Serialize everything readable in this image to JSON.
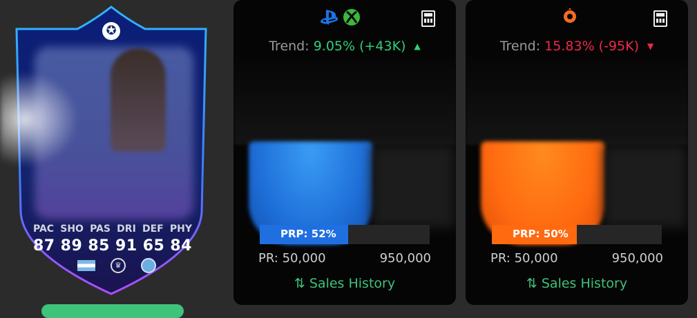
{
  "card": {
    "stat_labels": [
      "PAC",
      "SHO",
      "PAS",
      "DRI",
      "DEF",
      "PHY"
    ],
    "stats": [
      "87",
      "89",
      "85",
      "91",
      "65",
      "84"
    ],
    "league_icon": "premier-league-icon",
    "club_icon": "manchester-city-icon",
    "nation_icon": "argentina-flag-icon"
  },
  "panels": [
    {
      "platforms": [
        "playstation-icon",
        "xbox-icon"
      ],
      "trend_label": "Trend:",
      "trend_value": "9.05% (+43K)",
      "trend_direction": "up",
      "prp_label": "PRP: 52%",
      "prp_value": 0.52,
      "range_min": "PR: 50,000",
      "range_max": "950,000",
      "sales_history": "Sales History",
      "accent": "#1f6fe0"
    },
    {
      "platforms": [
        "origin-icon"
      ],
      "trend_label": "Trend:",
      "trend_value": "15.83% (-95K)",
      "trend_direction": "down",
      "prp_label": "PRP: 50%",
      "prp_value": 0.5,
      "range_min": "PR: 50,000",
      "range_max": "950,000",
      "sales_history": "Sales History",
      "accent": "#ff6a10"
    }
  ],
  "colors": {
    "up": "#2fd07a",
    "down": "#f0284a",
    "link": "#3fc27a"
  }
}
